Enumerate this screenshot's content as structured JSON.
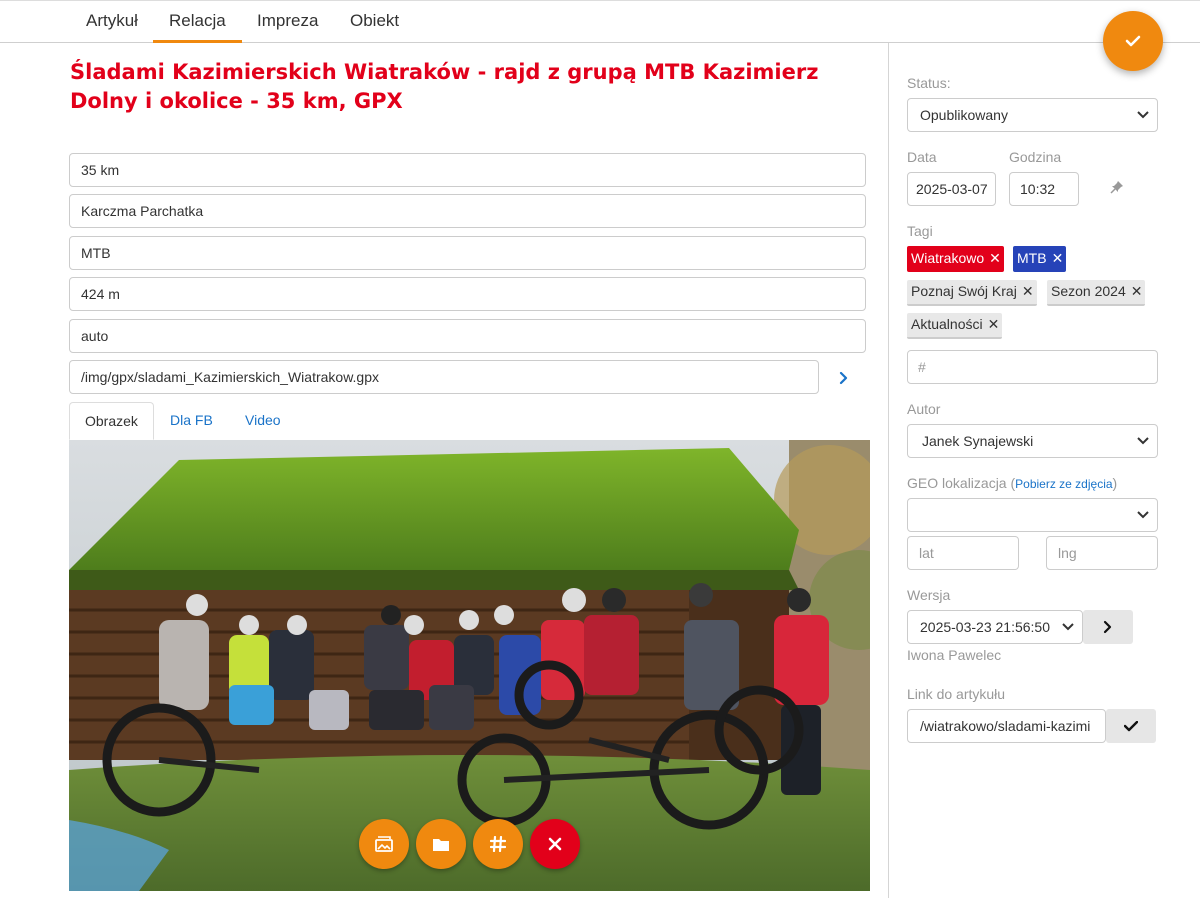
{
  "tabs": [
    {
      "label": "Artykuł",
      "active": false
    },
    {
      "label": "Relacja",
      "active": true
    },
    {
      "label": "Impreza",
      "active": false
    },
    {
      "label": "Obiekt",
      "active": false
    }
  ],
  "colors": {
    "accent": "#f0890f",
    "title": "#e2001a",
    "link": "#1a73c8",
    "tag_red": "#e2001a",
    "tag_blue": "#2643b8",
    "danger": "#e2001a"
  },
  "main": {
    "title": "Śladami Kazimierskich Wiatraków - rajd z grupą MTB Kazimierz Dolny i okolice - 35 km, GPX",
    "fields": {
      "distance": "35 km",
      "start": "Karczma Parchatka",
      "type": "MTB",
      "elevation": "424 m",
      "transport": "auto",
      "gpx_path": "/img/gpx/sladami_Kazimierskich_Wiatrakow.gpx"
    },
    "image_tabs": [
      {
        "label": "Obrazek",
        "active": true
      },
      {
        "label": "Dla FB",
        "active": false
      },
      {
        "label": "Video",
        "active": false
      }
    ],
    "photo_icons": [
      "image-icon",
      "folder-icon",
      "hashtag-icon",
      "close-icon"
    ]
  },
  "sidebar": {
    "status_label": "Status:",
    "status_value": "Opublikowany",
    "date_label": "Data",
    "date_value": "2025-03-07",
    "time_label": "Godzina",
    "time_value": "10:32",
    "tags_label": "Tagi",
    "tags": [
      {
        "label": "Wiatrakowo",
        "style": "red"
      },
      {
        "label": "MTB",
        "style": "blue"
      },
      {
        "label": "Poznaj Swój Kraj",
        "style": "grey"
      },
      {
        "label": "Sezon 2024",
        "style": "grey"
      },
      {
        "label": "Aktualności",
        "style": "grey"
      }
    ],
    "tag_input_placeholder": "#",
    "author_label": "Autor",
    "author_value": "Janek Synajewski",
    "geo_label": "GEO lokalizacja (",
    "geo_link": "Pobierz ze zdjęcia",
    "geo_label_end": ")",
    "geo_select_value": "",
    "lat_placeholder": "lat",
    "lng_placeholder": "lng",
    "version_label": "Wersja",
    "version_value": "2025-03-23 21:56:50",
    "version_author": "Iwona Pawelec",
    "link_label": "Link do artykułu",
    "link_value": "/wiatrakowo/sladami-kazimi"
  }
}
